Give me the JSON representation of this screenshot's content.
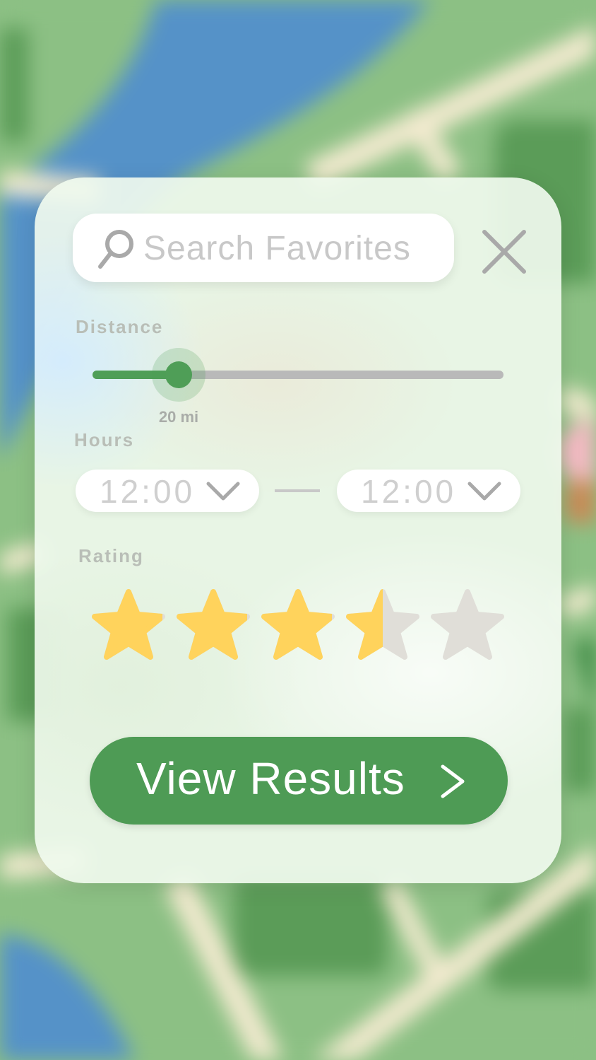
{
  "search": {
    "placeholder": "Search Favorites",
    "value": ""
  },
  "icons": {
    "search": "search-icon",
    "close": "close-icon",
    "chevron": "chevron-down-icon",
    "star": "star-icon",
    "arrow": "chevron-right-icon"
  },
  "distance": {
    "label": "Distance",
    "value_label": "20 mi",
    "fraction": 0.21
  },
  "hours": {
    "label": "Hours",
    "from": "12:00",
    "to": "12:00"
  },
  "rating": {
    "label": "Rating",
    "value": 3.5,
    "max": 5
  },
  "results_button": {
    "label": "View Results"
  },
  "colors": {
    "accent": "#4f9e57",
    "star_filled": "#ffd35c",
    "star_empty": "#e0ded8",
    "track": "#b9b9b9",
    "map_green": "#8cc084",
    "map_dark_green": "#5b9c58",
    "map_water": "#5592c8",
    "map_road": "#f2eacf"
  }
}
